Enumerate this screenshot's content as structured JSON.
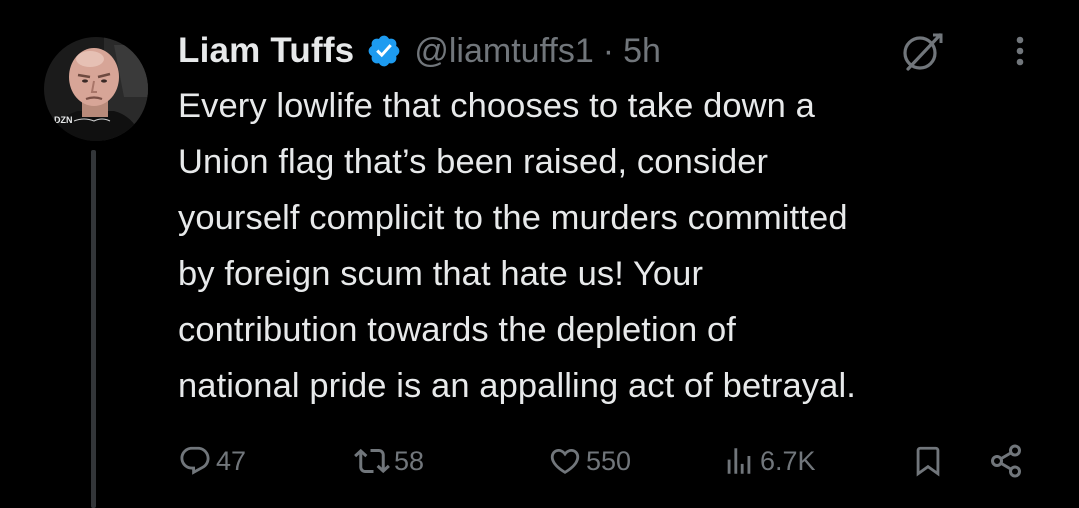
{
  "author": {
    "display_name": "Liam Tuffs",
    "handle": "@liamtuffs1",
    "separator": "·",
    "time": "5h",
    "avatar_overlay_text": "DZN",
    "verified_color": "#1d9bf0"
  },
  "tweet": {
    "text": "Every lowlife that chooses to take down a\nUnion flag that’s been raised, consider\nyourself complicit to the murders committed\nby foreign scum that hate us! Your\ncontribution towards the depletion of\nnational pride is an appalling act of betrayal."
  },
  "actions": {
    "reply_count": "47",
    "repost_count": "58",
    "like_count": "550",
    "views_count": "6.7K"
  },
  "icons": {
    "reply": "reply-icon",
    "repost": "repost-icon",
    "like": "heart-icon",
    "views": "views-icon",
    "bookmark": "bookmark-icon",
    "share": "share-icon",
    "grok": "grok-icon",
    "more": "more-icon"
  },
  "colors": {
    "background": "#000000",
    "text": "#e7e9ea",
    "secondary": "#71767b",
    "accent": "#1d9bf0"
  }
}
